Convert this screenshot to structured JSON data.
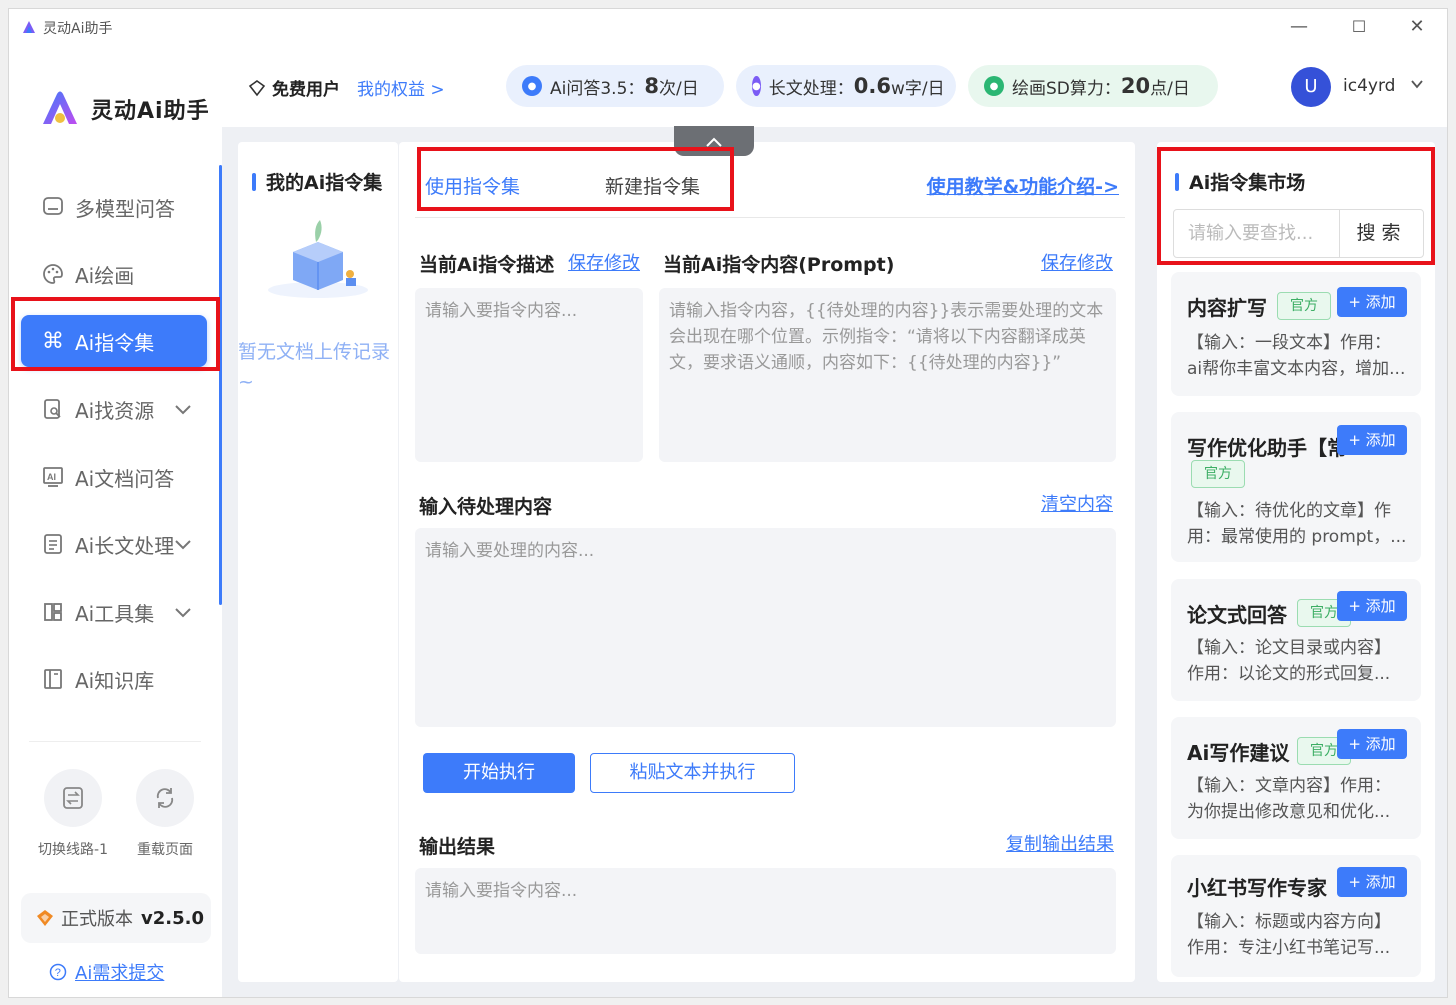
{
  "window": {
    "title": "灵动Ai助手",
    "controls": {
      "minimize": "—",
      "maximize": "☐",
      "close": "✕"
    }
  },
  "brand": {
    "name": "灵动Ai助手"
  },
  "sidebar": {
    "items": [
      {
        "label": "多模型问答",
        "icon": "chat-box-icon",
        "has_chevron": false
      },
      {
        "label": "Ai绘画",
        "icon": "palette-icon",
        "has_chevron": false
      },
      {
        "label": "Ai指令集",
        "icon": "command-icon",
        "has_chevron": false,
        "active": true
      },
      {
        "label": "Ai找资源",
        "icon": "search-doc-icon",
        "has_chevron": true
      },
      {
        "label": "Ai文档问答",
        "icon": "ai-doc-icon",
        "has_chevron": false
      },
      {
        "label": "Ai长文处理",
        "icon": "long-text-icon",
        "has_chevron": true
      },
      {
        "label": "Ai工具集",
        "icon": "tools-icon",
        "has_chevron": true
      },
      {
        "label": "Ai知识库",
        "icon": "book-icon",
        "has_chevron": false
      }
    ],
    "switch_line": "切换线路-1",
    "reload": "重载页面",
    "version_label": "正式版本",
    "version": "v2.5.0",
    "feedback": "Ai需求提交"
  },
  "topbar": {
    "user_type": "免费用户",
    "rights": "我的权益 >",
    "quotas": [
      {
        "label": "Ai问答3.5：",
        "value": "8",
        "unit": "次/日",
        "color": "#3d7bfa"
      },
      {
        "label": "长文处理：",
        "value": "0.6",
        "unit": "w字/日",
        "color": "#7b5cf5"
      },
      {
        "label": "绘画SD算力：",
        "value": "20",
        "unit": "点/日",
        "color": "#2bb673"
      }
    ],
    "avatar_letter": "U",
    "username": "ic4yrd"
  },
  "doc_panel": {
    "title": "我的Ai指令集",
    "empty_text": "暂无文档上传记录~"
  },
  "center": {
    "tabs": [
      "使用指令集",
      "新建指令集"
    ],
    "tutorial_link": "使用教学&功能介绍->",
    "desc_label": "当前Ai指令描述",
    "desc_save": "保存修改",
    "desc_placeholder": "请输入要指令内容...",
    "prompt_label": "当前Ai指令内容(Prompt)",
    "prompt_save": "保存修改",
    "prompt_placeholder": "请输入指令内容，{{待处理的内容}}表示需要处理的文本会出现在哪个位置。示例指令：“请将以下内容翻译成英文，要求语义通顺，内容如下：{{待处理的内容}}”",
    "input_label": "输入待处理内容",
    "clear": "清空内容",
    "input_placeholder": "请输入要处理的内容...",
    "run_button": "开始执行",
    "paste_button": "粘贴文本并执行",
    "output_label": "输出结果",
    "copy_output": "复制输出结果",
    "output_placeholder": "请输入要指令内容..."
  },
  "market": {
    "title": "Ai指令集市场",
    "search_placeholder": "请输入要查找...",
    "search_button": "搜索",
    "add_label": "+ 添加",
    "badge": "官方",
    "cards": [
      {
        "title": "内容扩写",
        "lines": [
          "【输入：一段文本】作用：",
          "ai帮你丰富文本内容，增加..."
        ]
      },
      {
        "title": "写作优化助手【常",
        "lines": [
          "【输入：待优化的文章】作",
          "用：最常使用的 prompt，..."
        ]
      },
      {
        "title": "论文式回答",
        "lines": [
          "【输入：论文目录或内容】",
          "作用：以论文的形式回复..."
        ]
      },
      {
        "title": "Ai写作建议",
        "lines": [
          "【输入：文章内容】作用：",
          "为你提出修改意见和优化..."
        ]
      },
      {
        "title": "小红书写作专家",
        "lines": [
          "【输入：标题或内容方向】",
          "作用：专注小红书笔记写..."
        ]
      }
    ]
  }
}
